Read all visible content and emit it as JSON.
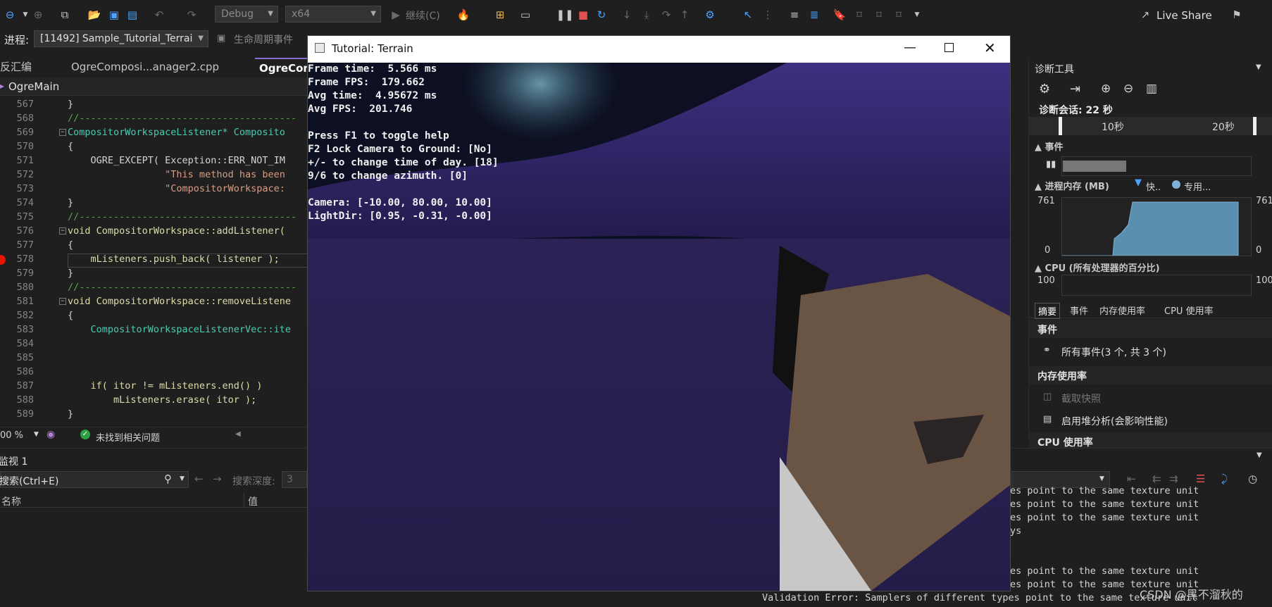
{
  "toolbar": {
    "config": "Debug",
    "platform": "x64",
    "continue_label": "继续(C)",
    "live_share": "Live Share"
  },
  "process_bar": {
    "label": "进程:",
    "process": "[11492] Sample_Tutorial_Terrai",
    "lifecycle": "生命周期事件",
    "thread": "线程:",
    "stack": "堆栈帧:"
  },
  "tabs": [
    "反汇编",
    "OgreComposi...anager2.cpp",
    "OgreCom"
  ],
  "scope": "OgreMain",
  "code_lines": [
    {
      "n": "567",
      "text": "}"
    },
    {
      "n": "568",
      "text": "//--------------------------------------"
    },
    {
      "n": "569",
      "text": "CompositorWorkspaceListener* Composito"
    },
    {
      "n": "570",
      "text": "{"
    },
    {
      "n": "571",
      "text": "    OGRE_EXCEPT( Exception::ERR_NOT_IM"
    },
    {
      "n": "572",
      "text": "                 \"This method has been"
    },
    {
      "n": "573",
      "text": "                 \"CompositorWorkspace:"
    },
    {
      "n": "574",
      "text": "}"
    },
    {
      "n": "575",
      "text": "//--------------------------------------"
    },
    {
      "n": "576",
      "text": "void CompositorWorkspace::addListener("
    },
    {
      "n": "577",
      "text": "{"
    },
    {
      "n": "578",
      "text": "    mListeners.push_back( listener );"
    },
    {
      "n": "579",
      "text": "}"
    },
    {
      "n": "580",
      "text": "//--------------------------------------"
    },
    {
      "n": "581",
      "text": "void CompositorWorkspace::removeListene"
    },
    {
      "n": "582",
      "text": "{"
    },
    {
      "n": "583",
      "text": "    CompositorWorkspaceListenerVec::ite"
    },
    {
      "n": "584",
      "text": ""
    },
    {
      "n": "585",
      "text": ""
    },
    {
      "n": "586",
      "text": ""
    },
    {
      "n": "587",
      "text": "    if( itor != mListeners.end() )"
    },
    {
      "n": "588",
      "text": "        mListeners.erase( itor );"
    },
    {
      "n": "589",
      "text": "}"
    }
  ],
  "editor_status": {
    "zoom": "00 %",
    "issues": "未找到相关问题"
  },
  "game_window": {
    "title": "Tutorial: Terrain",
    "overlay": [
      "Frame time:  5.566 ms",
      "Frame FPS:  179.662",
      "Avg time:  4.95672 ms",
      "Avg FPS:  201.746",
      "",
      "Press F1 to toggle help",
      "F2 Lock Camera to Ground: [No]",
      "+/- to change time of day. [18]",
      "9/6 to change azimuth. [0]",
      "",
      "Camera: [-10.00, 80.00, 10.00]",
      "LightDir: [0.95, -0.31, -0.00]"
    ]
  },
  "diagnostics": {
    "title": "诊断工具",
    "session": "诊断会话: 22 秒",
    "timeline": [
      "10秒",
      "20秒"
    ],
    "events_header": "事件",
    "memory_header": "进程内存 (MB)",
    "memory_legend": [
      "快..",
      "专用..."
    ],
    "memory_max": "761",
    "memory_min": "0",
    "cpu_header": "CPU (所有处理器的百分比)",
    "cpu_max": "100",
    "tabs": [
      "摘要",
      "事件",
      "内存使用率",
      "CPU 使用率"
    ],
    "section_events": "事件",
    "all_events": "所有事件(3 个, 共 3 个)",
    "section_memory": "内存使用率",
    "snapshot": "截取快照",
    "heap": "启用堆分析(会影响性能)",
    "section_cpu": "CPU 使用率"
  },
  "watch": {
    "title": "监视 1",
    "search": "搜索(Ctrl+E)",
    "depth_label": "搜索深度:",
    "depth_value": "3",
    "col_name": "名称",
    "col_value": "值"
  },
  "output_lines": [
    "es point to the same texture unit",
    "es point to the same texture unit",
    "es point to the same texture unit",
    "ys",
    "",
    "",
    "es point to the same texture unit",
    "es point to the same texture unit",
    "Validation Error: Samplers of different types point to the same texture unit"
  ],
  "watermark": "CSDN @黑不溜秋的",
  "colors": {
    "accent": "#8c6cd8",
    "breakpoint": "#e51400",
    "memory_fill": "#5b8fb0"
  }
}
